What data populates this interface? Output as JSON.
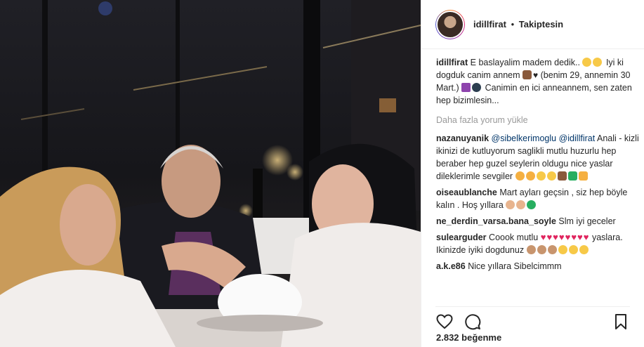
{
  "header": {
    "username": "idillfirat",
    "separator": "•",
    "follow_status": "Takiptesin"
  },
  "caption": {
    "username": "idillfirat",
    "text_1": "E baslayalim madem dedik..",
    "text_2": "Iyi ki dogduk canim annem",
    "text_3": "(benim 29, annemin 30 Mart.)",
    "text_4": "Canimin en ici anneannem, sen zaten hep bizimlesin..."
  },
  "load_more": "Daha fazla yorum yükle",
  "comments": [
    {
      "user": "nazanuyanik",
      "mention_1": "@sibelkerimoglu",
      "mention_2": "@idillfirat",
      "text": "Anali - kizli ikinizi de kutluyorum saglikli mutlu huzurlu hep beraber hep guzel seylerin oldugu nice yaslar dileklerimle sevgiler"
    },
    {
      "user": "oiseaublanche",
      "text": "Mart ayları geçsin , siz hep böyle kalın . Hoş yıllara"
    },
    {
      "user": "ne_derdin_varsa.bana_soyle",
      "text": "Slm iyi geceler"
    },
    {
      "user": "sulearguder",
      "text_1": "Coook mutlu",
      "text_2": "yaslara. Ikinizde iyiki dogdunuz"
    },
    {
      "user": "a.k.e86",
      "text": "Nice yıllara Sibelcimmm"
    }
  ],
  "likes": "2.832 beğenme",
  "icons": {
    "like": "heart-outline-icon",
    "comment": "comment-bubble-icon",
    "save": "bookmark-icon"
  },
  "colors": {
    "text": "#262626",
    "muted": "#999999",
    "mention": "#003569",
    "heart": "#e0245e",
    "border": "#efefef"
  }
}
